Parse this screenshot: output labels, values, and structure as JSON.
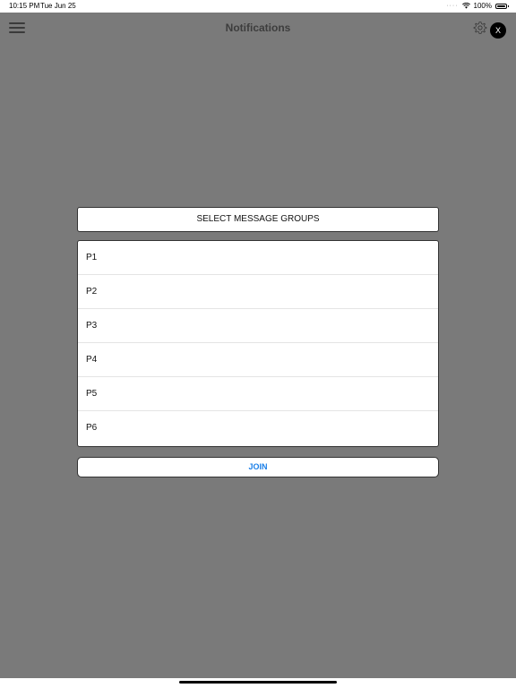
{
  "status_bar": {
    "time": "10:15 PM",
    "date": "Tue Jun 25",
    "battery": "100%",
    "icons": [
      "wifi-icon",
      "battery-icon"
    ]
  },
  "nav": {
    "title": "Notifications",
    "close_label": "X",
    "icons": [
      "hamburger-menu-icon",
      "gear-icon"
    ]
  },
  "dialog": {
    "header": "SELECT MESSAGE GROUPS",
    "groups": [
      {
        "label": "P1"
      },
      {
        "label": "P2"
      },
      {
        "label": "P3"
      },
      {
        "label": "P4"
      },
      {
        "label": "P5"
      },
      {
        "label": "P6"
      }
    ],
    "join_label": "JOIN"
  },
  "colors": {
    "overlay": "#7a7a7a",
    "accent": "#1a7fe8"
  }
}
